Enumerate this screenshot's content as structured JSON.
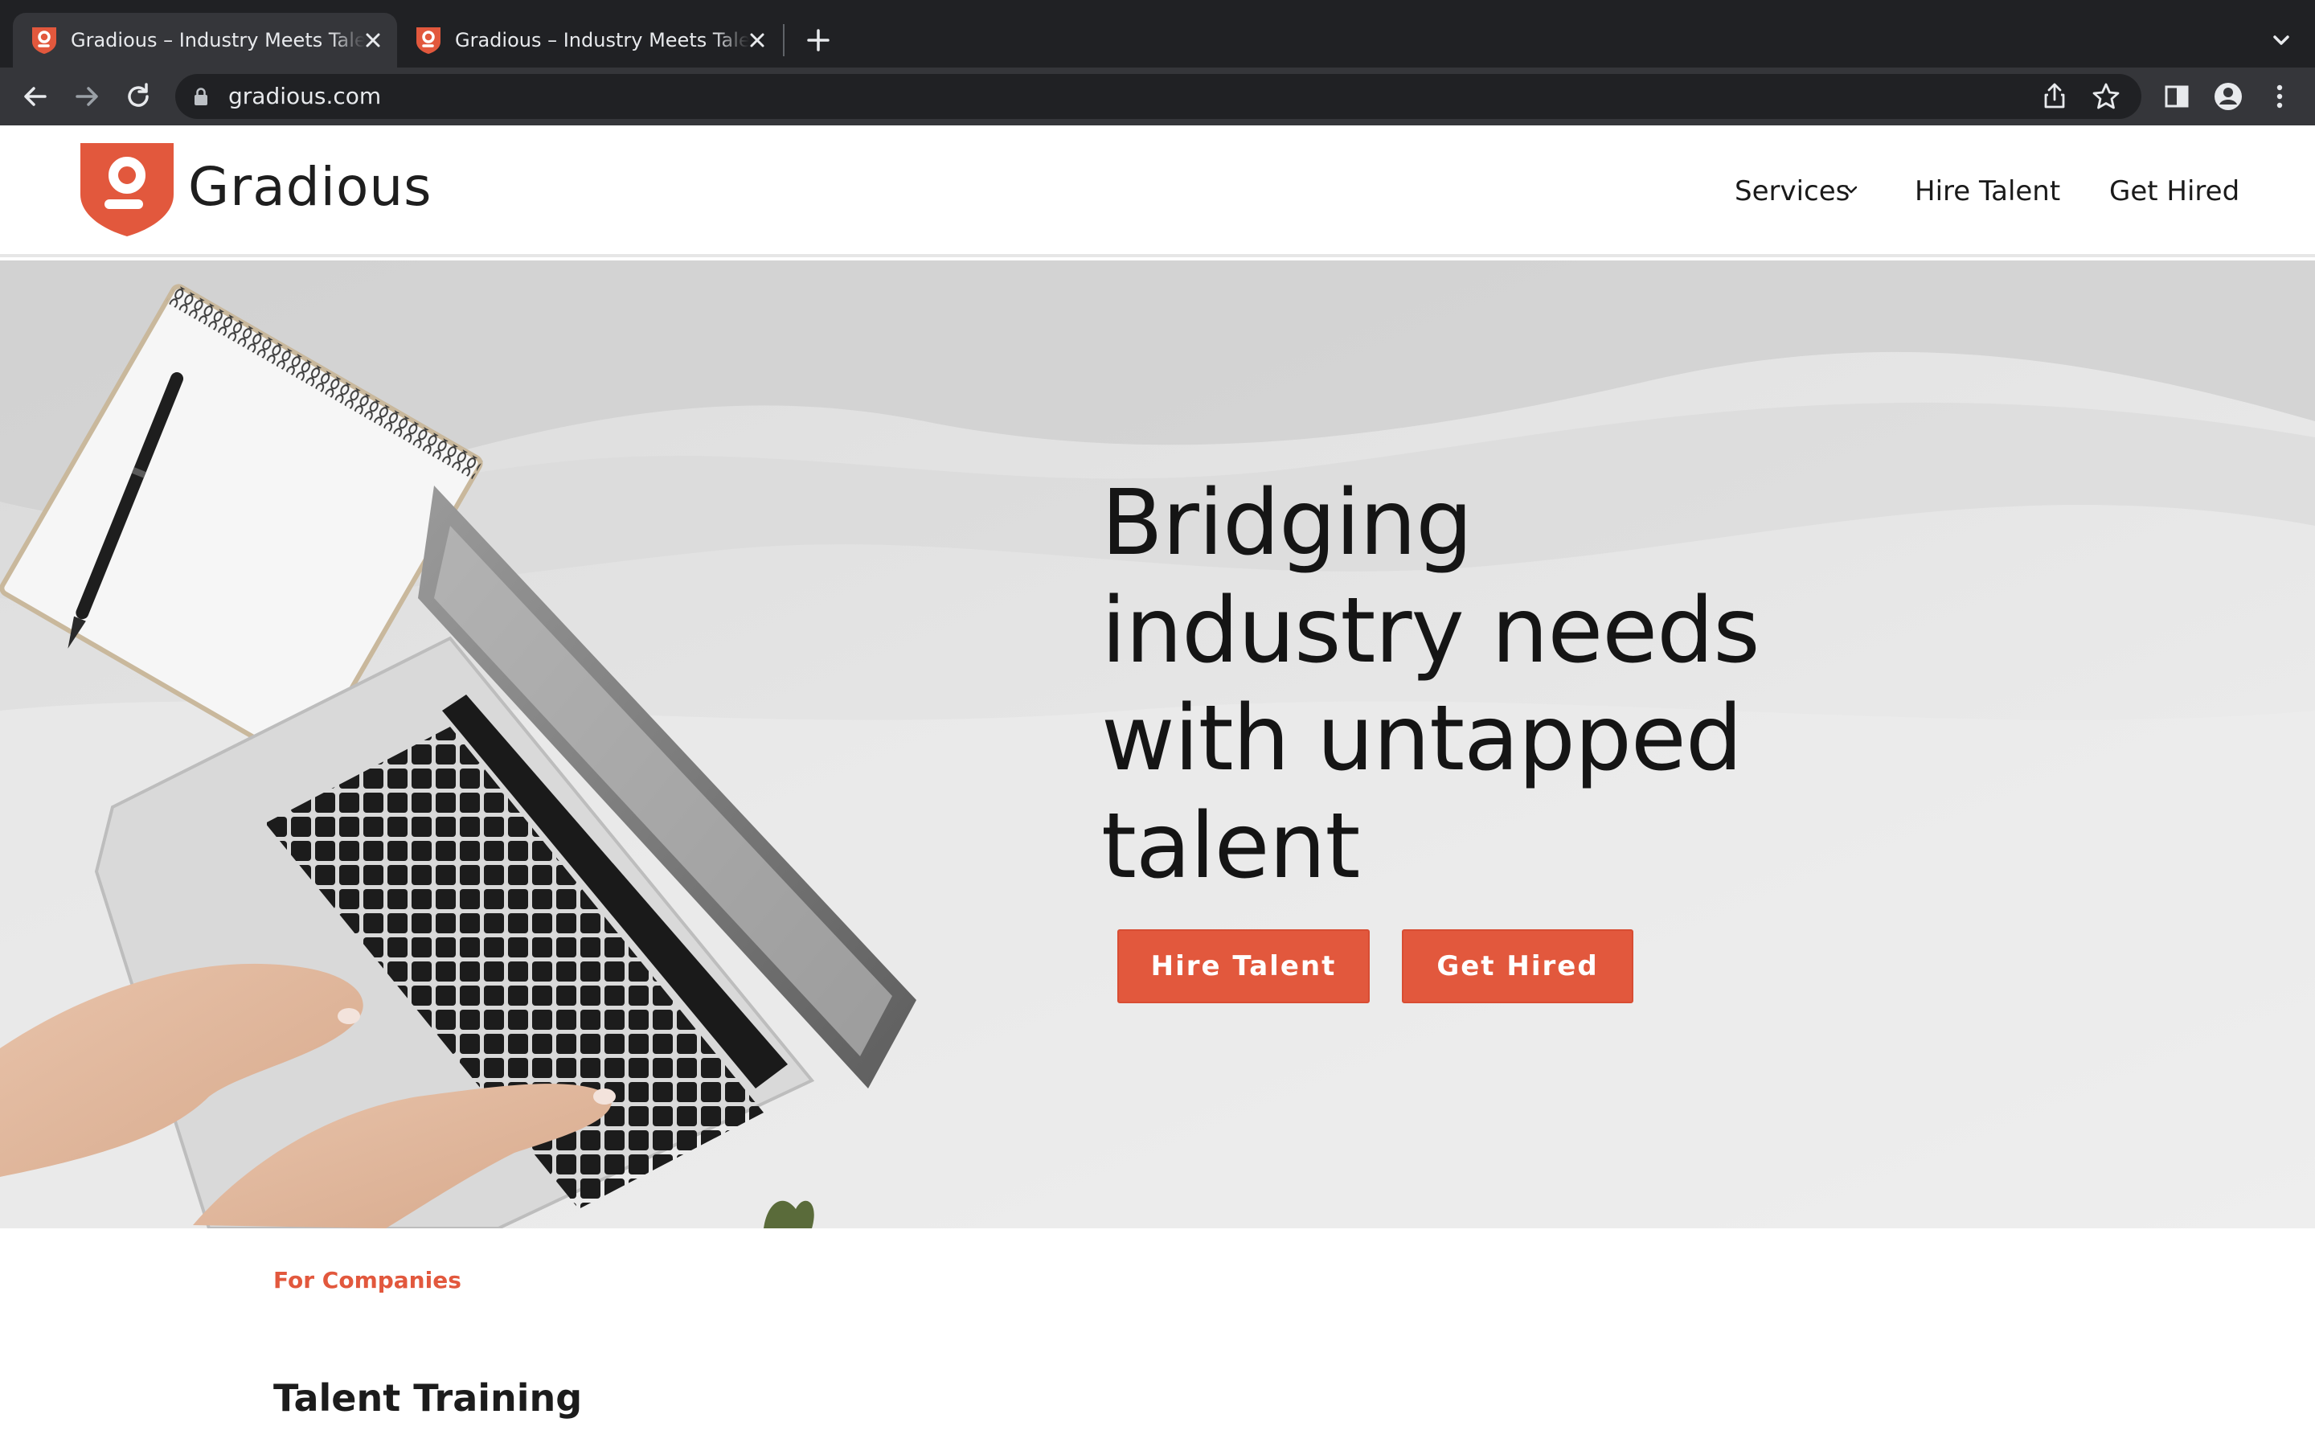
{
  "browser": {
    "tabs": [
      {
        "title": "Gradious – Industry Meets Talent",
        "active": true
      },
      {
        "title": "Gradious – Industry Meets Talent",
        "active": false
      }
    ],
    "url": "gradious.com"
  },
  "site": {
    "brand": "Gradious",
    "logo_letter": "g",
    "nav": {
      "services": "Services",
      "hire_talent": "Hire Talent",
      "get_hired": "Get Hired"
    }
  },
  "hero": {
    "headline": "Bridging industry needs with untapped talent",
    "buttons": {
      "hire_talent": "Hire Talent",
      "get_hired": "Get Hired"
    }
  },
  "section": {
    "kicker": "For Companies",
    "title": "Talent Training"
  },
  "colors": {
    "accent": "#e2583d",
    "chrome_dark": "#202124",
    "chrome_toolbar": "#35363a"
  },
  "icons": {
    "tab_favicon": "gradious-shield-icon",
    "tab_close": "close-icon",
    "new_tab": "plus-icon",
    "tab_list": "chevron-down-icon",
    "back": "arrow-left-icon",
    "forward": "arrow-right-icon",
    "reload": "reload-icon",
    "lock": "lock-icon",
    "share": "share-icon",
    "bookmark": "star-icon",
    "side_panel": "side-panel-icon",
    "profile": "profile-icon",
    "menu": "kebab-menu-icon"
  }
}
